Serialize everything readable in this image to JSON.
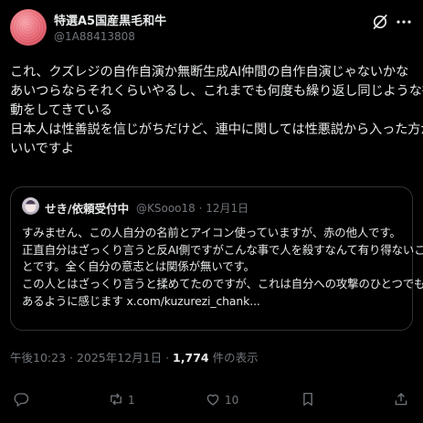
{
  "author": {
    "display_name": "特選A5国産黒毛和牛",
    "handle": "@1A88413808"
  },
  "tweet": {
    "lines": [
      "これ、クズレジの自作自演か無断生成AI仲間の自作自演じゃないかな",
      "あいつらならそれくらいやるし、これまでも何度も繰り返し同じような行",
      "動をしてきている",
      "日本人は性善説を信じがちだけど、連中に関しては性悪説から入った方が",
      "いいですよ"
    ]
  },
  "quote": {
    "display_name": "せき/依頼受付中",
    "meta": "@KSooo18 · 12月1日",
    "lines": [
      "すみません、この人自分の名前とアイコン使っていますが、赤の他人です。",
      "正直自分はざっくり言うと反AI側ですがこんな事で人を殺すなんて有り得ないこ",
      "とです。全く自分の意志とは関係が無いです。",
      "この人とはざっくり言うと揉めてたのですが、これは自分への攻撃のひとつでも",
      "あるように感じます x.com/kuzurezi_chank..."
    ]
  },
  "meta": {
    "time": "午後10:23 · 2025年12月1日 · ",
    "views_count": "1,774",
    "views_label": " 件の表示"
  },
  "actions": {
    "reply_count": "",
    "repost_count": "1",
    "like_count": "10"
  },
  "icons": {
    "grok": "grok-icon",
    "more": "more-icon",
    "reply": "reply-icon",
    "repost": "repost-icon",
    "like": "like-icon",
    "bookmark": "bookmark-icon",
    "share": "share-icon"
  },
  "colors": {
    "background": "#000000",
    "text": "#e7e9ea",
    "muted": "#71767b",
    "border": "#2f3336"
  }
}
